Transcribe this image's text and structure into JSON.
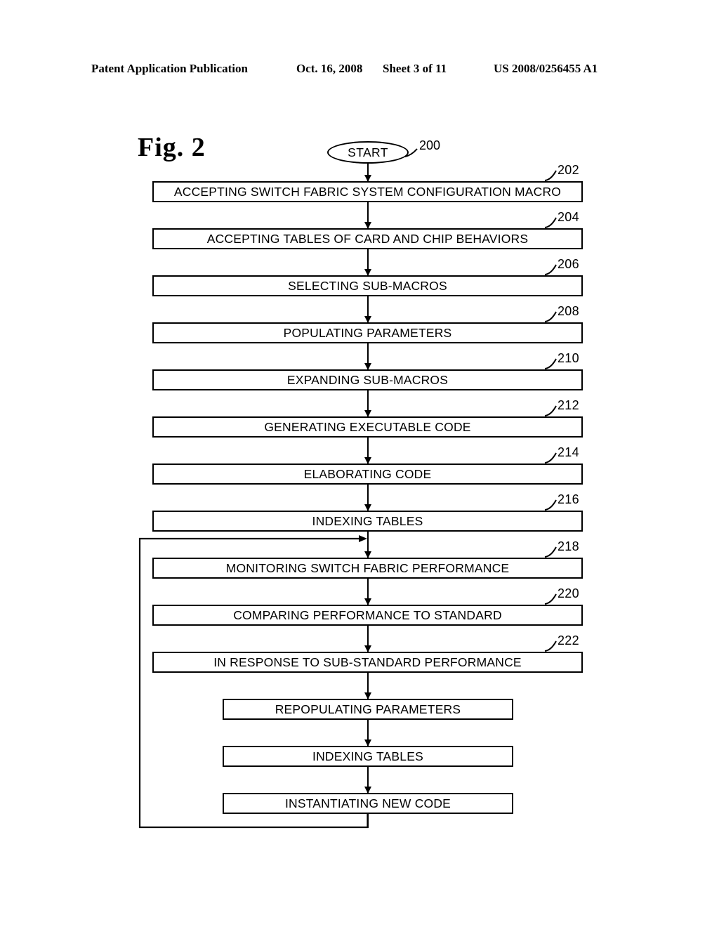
{
  "header": {
    "publication": "Patent Application Publication",
    "date": "Oct. 16, 2008",
    "sheet": "Sheet 3 of 11",
    "patent_number": "US 2008/0256455 A1"
  },
  "figure": {
    "title": "Fig. 2",
    "start_node": {
      "label": "START",
      "ref": "200"
    },
    "steps": [
      {
        "ref": "202",
        "label": "ACCEPTING SWITCH FABRIC SYSTEM CONFIGURATION MACRO",
        "width": "wide"
      },
      {
        "ref": "204",
        "label": "ACCEPTING TABLES OF CARD AND CHIP BEHAVIORS",
        "width": "wide"
      },
      {
        "ref": "206",
        "label": "SELECTING SUB-MACROS",
        "width": "wide"
      },
      {
        "ref": "208",
        "label": "POPULATING PARAMETERS",
        "width": "wide"
      },
      {
        "ref": "210",
        "label": "EXPANDING SUB-MACROS",
        "width": "wide"
      },
      {
        "ref": "212",
        "label": "GENERATING EXECUTABLE CODE",
        "width": "wide"
      },
      {
        "ref": "214",
        "label": "ELABORATING CODE",
        "width": "wide"
      },
      {
        "ref": "216",
        "label": "INDEXING TABLES",
        "width": "wide"
      },
      {
        "ref": "218",
        "label": "MONITORING SWITCH FABRIC PERFORMANCE",
        "width": "wide"
      },
      {
        "ref": "220",
        "label": "COMPARING PERFORMANCE TO STANDARD",
        "width": "wide"
      },
      {
        "ref": "222",
        "label": "IN RESPONSE TO SUB-STANDARD PERFORMANCE",
        "width": "wide"
      },
      {
        "ref": "",
        "label": "REPOPULATING PARAMETERS",
        "width": "narrow"
      },
      {
        "ref": "",
        "label": "INDEXING TABLES",
        "width": "narrow"
      },
      {
        "ref": "",
        "label": "INSTANTIATING NEW CODE",
        "width": "narrow"
      }
    ]
  },
  "colors": {
    "ink": "#000000",
    "paper": "#ffffff"
  }
}
